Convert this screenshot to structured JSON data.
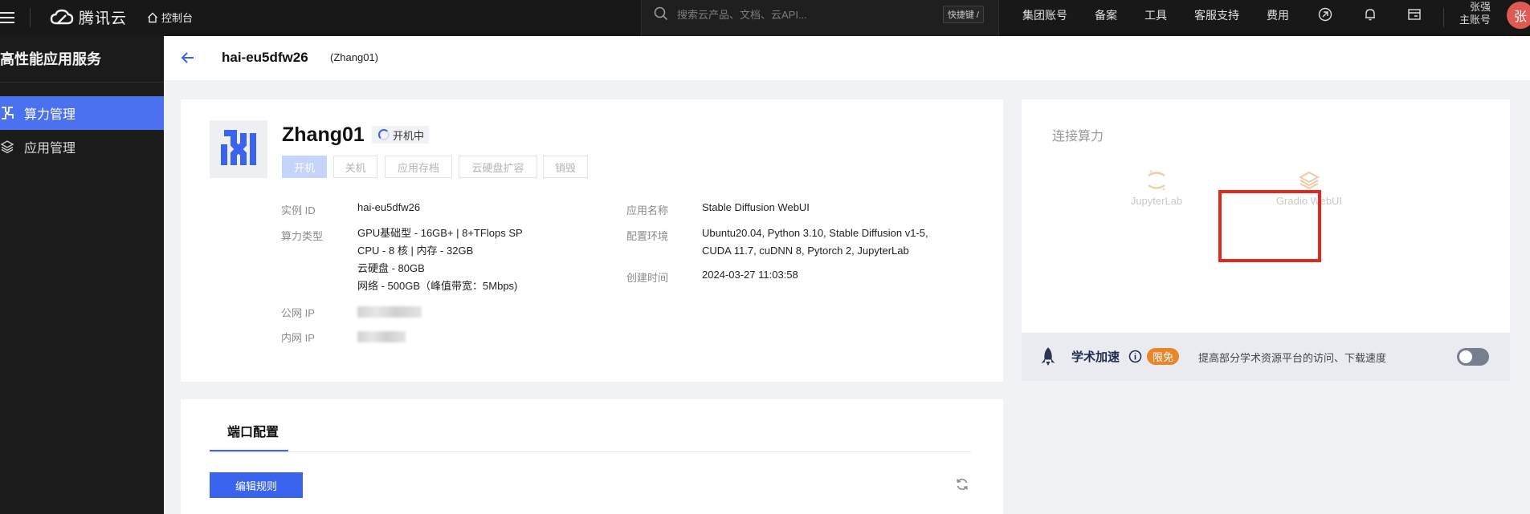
{
  "topbar": {
    "brand": "腾讯云",
    "console": "控制台",
    "search_placeholder": "搜索云产品、文档、云API...",
    "shortcut": "快捷键 /",
    "nav": [
      "集团账号",
      "备案",
      "工具",
      "客服支持",
      "费用"
    ],
    "account_name": "张强",
    "account_type": "主账号",
    "avatar": "张"
  },
  "sidebar": {
    "title": "高性能应用服务",
    "items": [
      {
        "label": "算力管理",
        "active": true,
        "icon": "compute-icon"
      },
      {
        "label": "应用管理",
        "active": false,
        "icon": "layers-icon"
      }
    ]
  },
  "header": {
    "title": "hai-eu5dfw26",
    "subtitle": "(Zhang01)"
  },
  "instance": {
    "name": "Zhang01",
    "status": "开机中",
    "actions": [
      "开机",
      "关机",
      "应用存档",
      "云硬盘扩容",
      "销毁"
    ],
    "left_fields": {
      "id_label": "实例 ID",
      "id_value": "hai-eu5dfw26",
      "type_label": "算力类型",
      "type_lines": [
        "GPU基础型 - 16GB+ | 8+TFlops SP",
        "CPU - 8 核 | 内存 - 32GB",
        "云硬盘 - 80GB",
        "网络 - 500GB（峰值带宽：5Mbps)"
      ],
      "public_ip_label": "公网 IP",
      "private_ip_label": "内网 IP"
    },
    "right_fields": {
      "app_label": "应用名称",
      "app_value": "Stable Diffusion WebUI",
      "env_label": "配置环境",
      "env_lines": [
        "Ubuntu20.04, Python 3.10, Stable Diffusion v1-5,",
        "CUDA 11.7, cuDNN 8, Pytorch 2, JupyterLab"
      ],
      "created_label": "创建时间",
      "created_value": "2024-03-27 11:03:58"
    }
  },
  "connect": {
    "title": "连接算力",
    "items": [
      {
        "label": "JupyterLab",
        "icon": "jupyter-icon"
      },
      {
        "label": "Gradio WebUI",
        "icon": "gradio-icon"
      }
    ]
  },
  "accel": {
    "title": "学术加速",
    "badge": "限免",
    "desc": "提高部分学术资源平台的访问、下载速度",
    "enabled": false
  },
  "ports": {
    "tab": "端口配置",
    "edit_button": "编辑规则"
  },
  "colors": {
    "accent": "#3a63ee",
    "highlight": "#e1271e",
    "badge": "#e8862a"
  }
}
